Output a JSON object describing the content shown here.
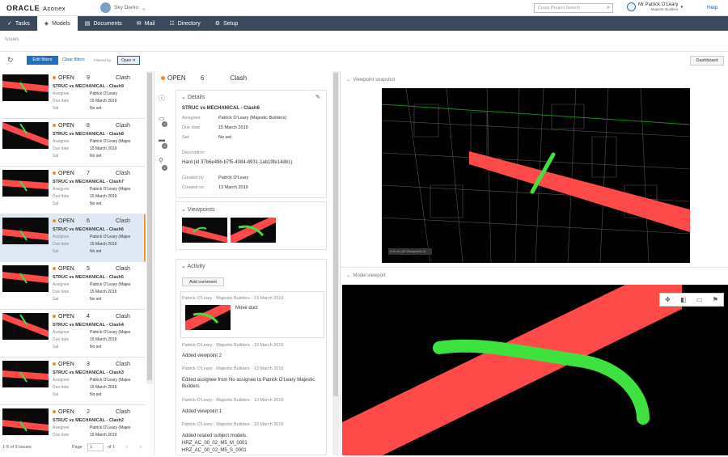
{
  "header": {
    "brand": "ORACLE",
    "product": "Aconex",
    "project": "Sky Demo",
    "search_placeholder": "Cross Project Search",
    "user_name": "Mr Patrick O'Leary",
    "user_org": "Majestic Builders",
    "help": "Help"
  },
  "nav": {
    "tabs": [
      {
        "label": "Tasks",
        "icon": "check-icon"
      },
      {
        "label": "Models",
        "icon": "cube-icon",
        "active": true
      },
      {
        "label": "Documents",
        "icon": "document-icon"
      },
      {
        "label": "Mail",
        "icon": "mail-icon"
      },
      {
        "label": "Directory",
        "icon": "directory-icon"
      },
      {
        "label": "Setup",
        "icon": "gear-icon"
      }
    ]
  },
  "breadcrumb": "Issues",
  "filters": {
    "edit_label": "Edit filters",
    "clear_label": "Clear filters",
    "filtered_by": "Filtered by:",
    "chip": "Open",
    "dashboard": "Dashboard"
  },
  "issues": [
    {
      "status": "OPEN",
      "num": "9",
      "type": "Clash",
      "title": "STRUC vs MECHANICAL - Clash9",
      "assignee": "Patrick O'Leary",
      "due": "15 March 2019",
      "sla": "No set"
    },
    {
      "status": "OPEN",
      "num": "8",
      "type": "Clash",
      "title": "STRUC vs MECHANICAL - Clash8",
      "assignee": "Patrick O'Leary (Majes",
      "due": "15 March 2019",
      "sla": "No set"
    },
    {
      "status": "OPEN",
      "num": "7",
      "type": "Clash",
      "title": "STRUC vs MECHANICAL - Clash7",
      "assignee": "Patrick O'Leary (Majes",
      "due": "15 March 2019",
      "sla": "No set"
    },
    {
      "status": "OPEN",
      "num": "6",
      "type": "Clash",
      "title": "STRUC vs MECHANICAL - Clash6",
      "assignee": "Patrick O'Leary (Majes",
      "due": "15 March 2019",
      "sla": "No set"
    },
    {
      "status": "OPEN",
      "num": "5",
      "type": "Clash",
      "title": "STRUC vs MECHANICAL - Clash5",
      "assignee": "Patrick O'Leary (Majes",
      "due": "15 March 2019",
      "sla": "No set"
    },
    {
      "status": "OPEN",
      "num": "4",
      "type": "Clash",
      "title": "STRUC vs MECHANICAL - Clash4",
      "assignee": "Patrick O'Leary (Majes",
      "due": "15 March 2019",
      "sla": "No set"
    },
    {
      "status": "OPEN",
      "num": "3",
      "type": "Clash",
      "title": "STRUC vs MECHANICAL - Clash3",
      "assignee": "Patrick O'Leary (Majes",
      "due": "15 March 2019",
      "sla": "No set"
    },
    {
      "status": "OPEN",
      "num": "2",
      "type": "Clash",
      "title": "STRUC vs MECHANICAL - Clash2",
      "assignee": "Patrick O'Leary (Majes",
      "due": "15 March 2019",
      "sla": "No set"
    }
  ],
  "field_labels": {
    "assignee": "Assignee",
    "due": "Due date",
    "sla": "Sat"
  },
  "pager": {
    "count": "1-9 of 9 issues",
    "page_label": "Page",
    "page": "1",
    "of": "of 1"
  },
  "detail": {
    "status": "OPEN",
    "num": "6",
    "type": "Clash",
    "details_header": "Details",
    "title": "STRUC vs MECHANICAL - Clash6",
    "assignee_label": "Assignee",
    "assignee": "Patrick O'Leary (Majestic Builders)",
    "due_label": "Due date",
    "due": "15 March 2019",
    "sla_label": "Sat",
    "sla": "No set",
    "desc_label": "Description",
    "desc": "Hard (id 37b6e49b-b7f5-4084-8931-1ab19fe14db1)",
    "created_by_label": "Created by",
    "created_by": "Patrick O'Leary",
    "created_on_label": "Created on",
    "created_on": "13 March 2019",
    "viewpoints_header": "Viewpoints",
    "activity_header": "Activity",
    "add_comment": "Add comment",
    "activity": [
      {
        "meta": "Patrick O'Leary · Majestic Builders · 13 March 2019",
        "text": "Move duct"
      },
      {
        "meta": "Patrick O'Leary · Majestic Builders · 13 March 2019",
        "text": "Added viewpoint 2"
      },
      {
        "meta": "Patrick O'Leary · Majestic Builders · 13 March 2019",
        "text": "Edited assignee from No assignee to Patrick O'Leary Majestic Builders"
      },
      {
        "meta": "Patrick O'Leary · Majestic Builders · 13 March 2019",
        "text": "Added viewpoint 1"
      },
      {
        "meta": "Patrick O'Leary · Majestic Builders · 13 March 2019",
        "text": "Added related subject models."
      },
      {
        "meta": "",
        "text": "HRZ_AC_00_02_M5_M_0001"
      },
      {
        "meta": "",
        "text": "HRZ_AC_00_02_M5_S_0001"
      }
    ]
  },
  "right": {
    "snapshot_header": "Viewpoint snapshot",
    "model_header": "Model viewport",
    "snap_tag": "4.00 m (All Viewpoints 2)"
  },
  "colors": {
    "nav_bg": "#3a4a5c",
    "accent": "#1e6fc0",
    "open_dot": "#f08a24",
    "clash_red": "#ff4a4a",
    "clash_green": "#3ee23e"
  }
}
